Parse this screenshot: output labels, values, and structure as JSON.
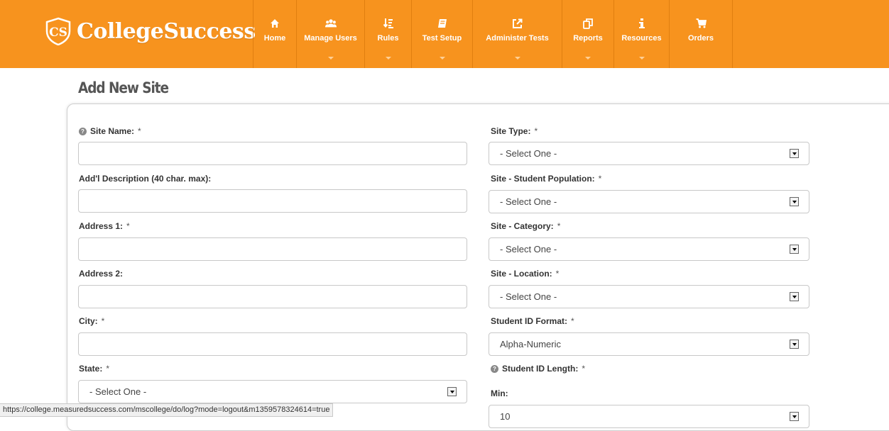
{
  "brand": {
    "name": "CollegeSuccess",
    "logo_letters": "CS"
  },
  "nav": [
    {
      "label": "Home",
      "icon": "home-icon",
      "dropdown": false
    },
    {
      "label": "Manage Users",
      "icon": "users-icon",
      "dropdown": true
    },
    {
      "label": "Rules",
      "icon": "sort-icon",
      "dropdown": true
    },
    {
      "label": "Test Setup",
      "icon": "book-icon",
      "dropdown": true
    },
    {
      "label": "Administer Tests",
      "icon": "external-link-icon",
      "dropdown": true
    },
    {
      "label": "Reports",
      "icon": "copy-icon",
      "dropdown": true
    },
    {
      "label": "Resources",
      "icon": "info-icon",
      "dropdown": true
    },
    {
      "label": "Orders",
      "icon": "cart-icon",
      "dropdown": false
    }
  ],
  "page_title": "Add New Site",
  "required_marker": "*",
  "form": {
    "left": {
      "site_name": {
        "label": "Site Name:",
        "value": ""
      },
      "description": {
        "label": "Add'l Description (40 char. max):",
        "value": ""
      },
      "address1": {
        "label": "Address 1:",
        "value": ""
      },
      "address2": {
        "label": "Address 2:",
        "value": ""
      },
      "city": {
        "label": "City:",
        "value": ""
      },
      "state": {
        "label": "State:",
        "value": "- Select One -"
      }
    },
    "right": {
      "site_type": {
        "label": "Site Type:",
        "value": "- Select One -"
      },
      "student_population": {
        "label": "Site - Student Population:",
        "value": "- Select One -"
      },
      "category": {
        "label": "Site - Category:",
        "value": "- Select One -"
      },
      "location": {
        "label": "Site - Location:",
        "value": "- Select One -"
      },
      "id_format": {
        "label": "Student ID Format:",
        "value": "Alpha-Numeric"
      },
      "id_length": {
        "label": "Student ID Length:"
      },
      "min": {
        "label": "Min:",
        "value": "10"
      }
    }
  },
  "status_url": "https://college.measuredsuccess.com/mscollege/do/log?mode=logout&m1359578324614=true",
  "colors": {
    "brand_orange": "#f7931e",
    "nav_divider": "#e07f10"
  }
}
